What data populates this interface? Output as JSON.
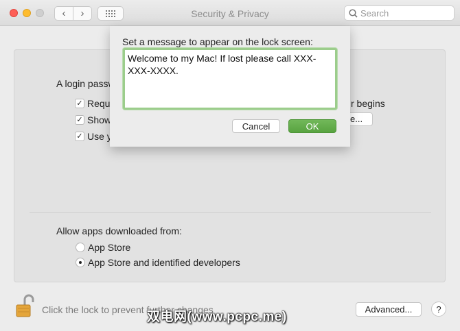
{
  "window": {
    "title": "Security & Privacy",
    "nav_back": "‹",
    "nav_forward": "›",
    "search_placeholder": "Search"
  },
  "general": {
    "login_label": "A login passw",
    "checkboxes": [
      {
        "label": "Requi",
        "checked": true
      },
      {
        "label": "Show",
        "checked": true
      },
      {
        "label": "Use y",
        "checked": true
      }
    ],
    "checkbox_glyph": "✓",
    "begins_text": "r begins",
    "partial_button": "e..."
  },
  "downloads": {
    "label": "Allow apps downloaded from:",
    "options": [
      {
        "label": "App Store",
        "selected": false
      },
      {
        "label": "App Store and identified developers",
        "selected": true
      }
    ]
  },
  "footer": {
    "lock_text": "Click the lock to prevent further changes",
    "advanced_label": "Advanced...",
    "help_label": "?",
    "watermark": "双电网(www.pcpc.me)"
  },
  "sheet": {
    "prompt": "Set a message to appear on the lock screen:",
    "message": "Welcome to my Mac! If lost please call XXX-XXX-XXXX.",
    "cancel_label": "Cancel",
    "ok_label": "OK"
  },
  "colors": {
    "accent_green": "#5aa543",
    "focus_ring": "#9ccd8c",
    "lock_gold": "#e4a53a"
  }
}
